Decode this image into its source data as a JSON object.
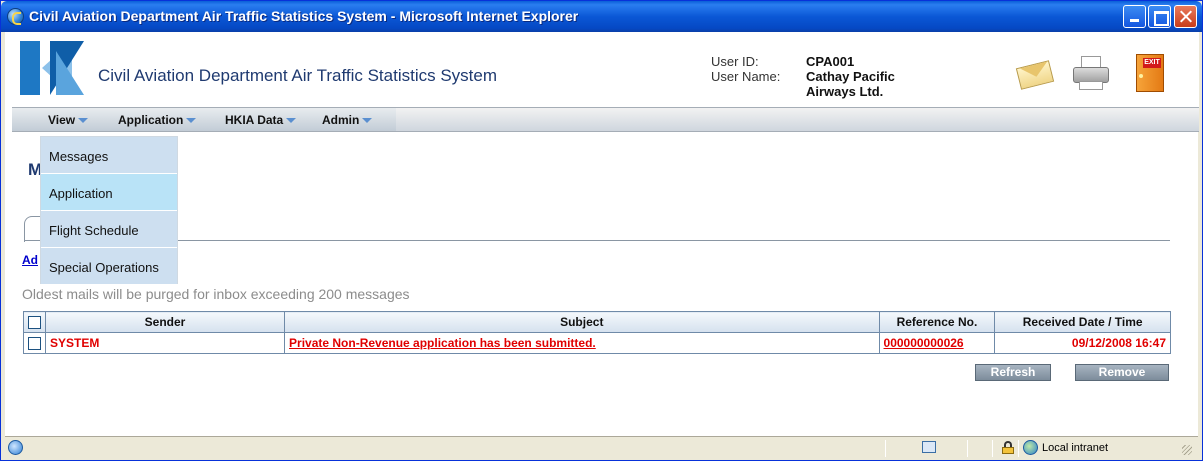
{
  "window": {
    "title": "Civil Aviation Department Air Traffic Statistics System - Microsoft Internet Explorer"
  },
  "header": {
    "system_title": "Civil Aviation Department Air Traffic Statistics System",
    "user_id_label": "User ID:",
    "user_id_value": "CPA001",
    "user_name_label": "User Name:",
    "user_name_value_line1": "Cathay Pacific",
    "user_name_value_line2": "Airways Ltd.",
    "exit_label": "EXIT"
  },
  "menu": {
    "items": [
      {
        "label": "View"
      },
      {
        "label": "Application"
      },
      {
        "label": "HKIA Data"
      },
      {
        "label": "Admin"
      }
    ],
    "accent_color": "#5a8fd0"
  },
  "dropdown": {
    "items": [
      {
        "label": "Messages"
      },
      {
        "label": "Application"
      },
      {
        "label": "Flight Schedule"
      },
      {
        "label": "Special Operations"
      }
    ],
    "hovered_index": 1
  },
  "page": {
    "partial_title_letter": "M",
    "partial_link": "Ad",
    "notice": "Oldest mails will be purged for inbox exceeding 200 messages"
  },
  "table": {
    "columns": [
      "Sender",
      "Subject",
      "Reference No.",
      "Received Date / Time"
    ],
    "rows": [
      {
        "sender": "SYSTEM",
        "subject": "Private Non-Revenue application has been submitted.",
        "reference": "000000000026",
        "received": "09/12/2008 16:47"
      }
    ],
    "row_text_color": "#e00000"
  },
  "buttons": {
    "refresh": "Refresh",
    "remove": "Remove"
  },
  "statusbar": {
    "zone": "Local intranet"
  }
}
